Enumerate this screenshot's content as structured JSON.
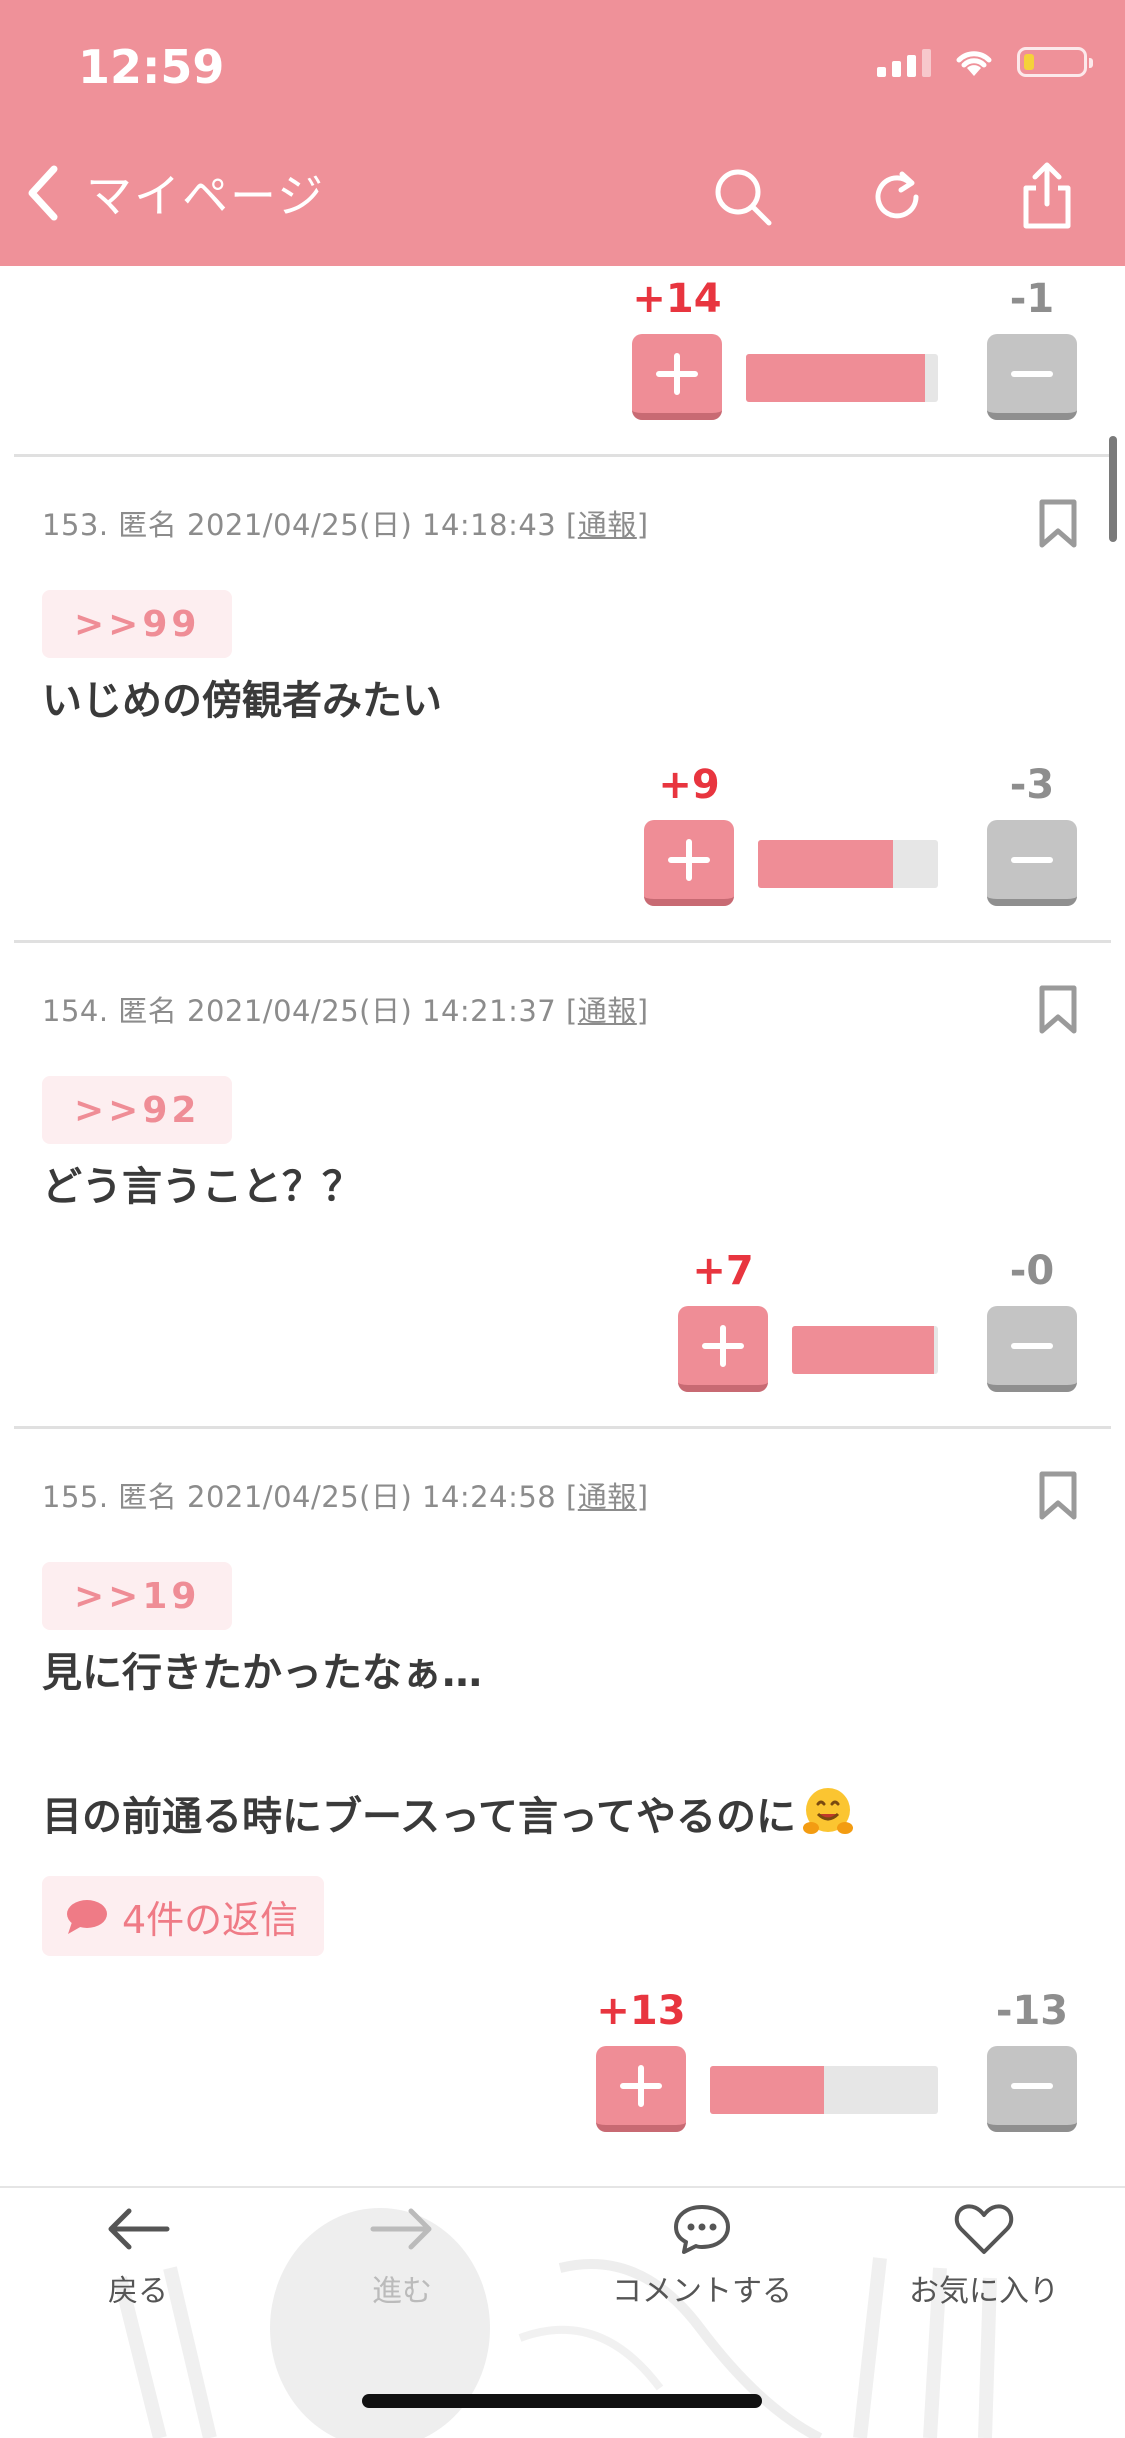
{
  "status_bar": {
    "time": "12:59"
  },
  "nav": {
    "back_label": "マイページ"
  },
  "top_vote": {
    "plus": "+14",
    "minus": "-1",
    "ratio": 0.93
  },
  "comments": [
    {
      "meta": "153. 匿名 2021/04/25(日) 14:18:43 [",
      "report": "通報",
      "meta_end": "]",
      "anchor": ">>99",
      "lines": [
        "いじめの傍観者みたい"
      ],
      "vote": {
        "plus": "+9",
        "minus": "-3",
        "ratio": 0.75
      }
    },
    {
      "meta": "154. 匿名 2021/04/25(日) 14:21:37 [",
      "report": "通報",
      "meta_end": "]",
      "anchor": ">>92",
      "lines": [
        "どう言うこと？？"
      ],
      "vote": {
        "plus": "+7",
        "minus": "-0",
        "ratio": 0.97
      }
    },
    {
      "meta": "155. 匿名 2021/04/25(日) 14:24:58 [",
      "report": "通報",
      "meta_end": "]",
      "anchor": ">>19",
      "lines": [
        "見に行きたかったなぁ…",
        "",
        "目の前通る時にブースって言ってやるのに"
      ],
      "reply_label": "4件の返信",
      "vote": {
        "plus": "+13",
        "minus": "-13",
        "ratio": 0.5
      }
    }
  ],
  "bottom_bar": {
    "back": "戻る",
    "forward": "進む",
    "comment": "コメントする",
    "favorite": "お気に入り"
  },
  "colors": {
    "header": "#ef9199",
    "plus": "#e8353f",
    "minus": "#8e8e8e",
    "accent": "#ef8d96"
  }
}
